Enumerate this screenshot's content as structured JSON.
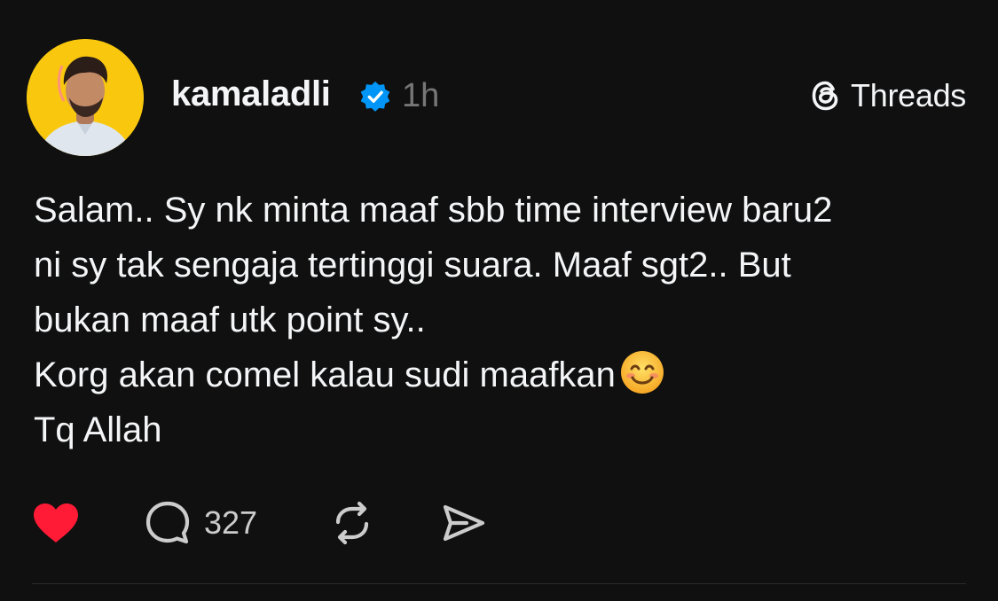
{
  "post": {
    "author": {
      "username": "kamaladli",
      "verified": true,
      "avatar_bg": "#f9c80e"
    },
    "timestamp": "1h",
    "brand": {
      "label": "Threads",
      "icon": "threads-logo-icon"
    },
    "lines": [
      "Salam.. Sy nk minta maaf sbb time interview baru2",
      "ni sy tak sengaja tertinggi suara. Maaf sgt2.. But",
      "bukan maaf utk point sy..",
      "Korg akan comel kalau sudi maafkan",
      "Tq Allah"
    ],
    "emoji": "smiling-face-emoji",
    "actions": {
      "like": {
        "icon": "heart-icon",
        "liked": true,
        "color": "#ff1a35"
      },
      "comment": {
        "icon": "comment-icon",
        "count": "327"
      },
      "repost": {
        "icon": "repost-icon"
      },
      "share": {
        "icon": "share-icon"
      }
    }
  },
  "colors": {
    "background": "#101010",
    "text": "#f3f5f7",
    "muted": "#777777",
    "verified": "#0095f6",
    "like": "#ff1a35"
  }
}
